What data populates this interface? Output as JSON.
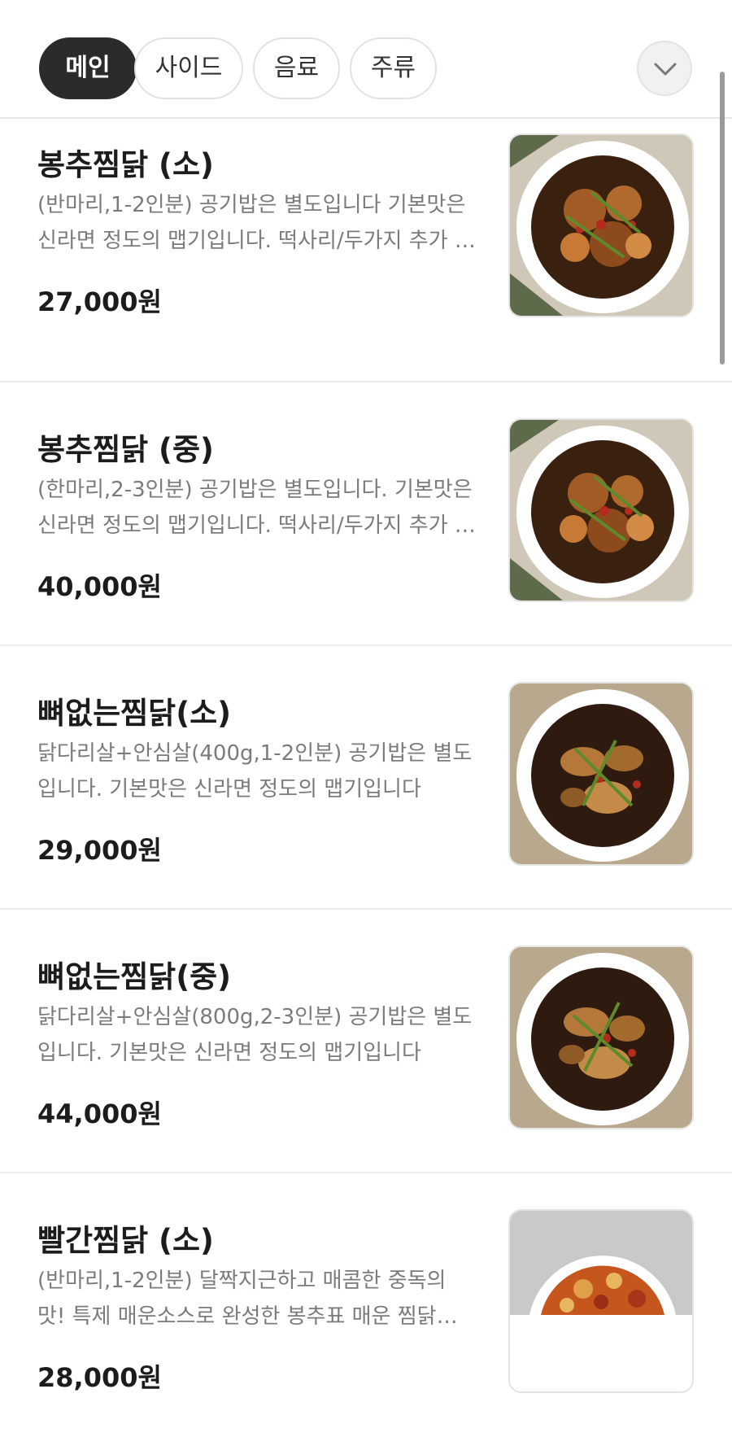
{
  "tabs": [
    {
      "label": "메인",
      "active": true
    },
    {
      "label": "사이드",
      "active": false
    },
    {
      "label": "음료",
      "active": false
    },
    {
      "label": "주류",
      "active": false
    }
  ],
  "expand_icon": "chevron-down-icon",
  "menu_items": [
    {
      "name": "봉추찜닭 (소)",
      "description": "(반마리,1-2인분) 공기밥은 별도입니다 기본맛은 신라면 정도의 맵기입니다. 떡사리/두가지 추가 가능합니다",
      "price": "27,000원"
    },
    {
      "name": "봉추찜닭 (중)",
      "description": "(한마리,2-3인분) 공기밥은 별도입니다. 기본맛은 신라면 정도의 맵기입니다. 떡사리/두가지 추가 가능합니다",
      "price": "40,000원"
    },
    {
      "name": "뼈없는찜닭(소)",
      "description": "닭다리살+안심살(400g,1-2인분) 공기밥은 별도입니다. 기본맛은 신라면 정도의 맵기입니다",
      "price": "29,000원"
    },
    {
      "name": "뼈없는찜닭(중)",
      "description": "닭다리살+안심살(800g,2-3인분) 공기밥은 별도입니다. 기본맛은 신라면 정도의 맵기입니다",
      "price": "44,000원"
    },
    {
      "name": "빨간찜닭 (소)",
      "description": "(반마리,1-2인분) 달짝지근하고 매콤한 중독의 맛! 특제 매운소스로 완성한 봉추표 매운 찜닭입니다",
      "price": "28,000원"
    }
  ]
}
